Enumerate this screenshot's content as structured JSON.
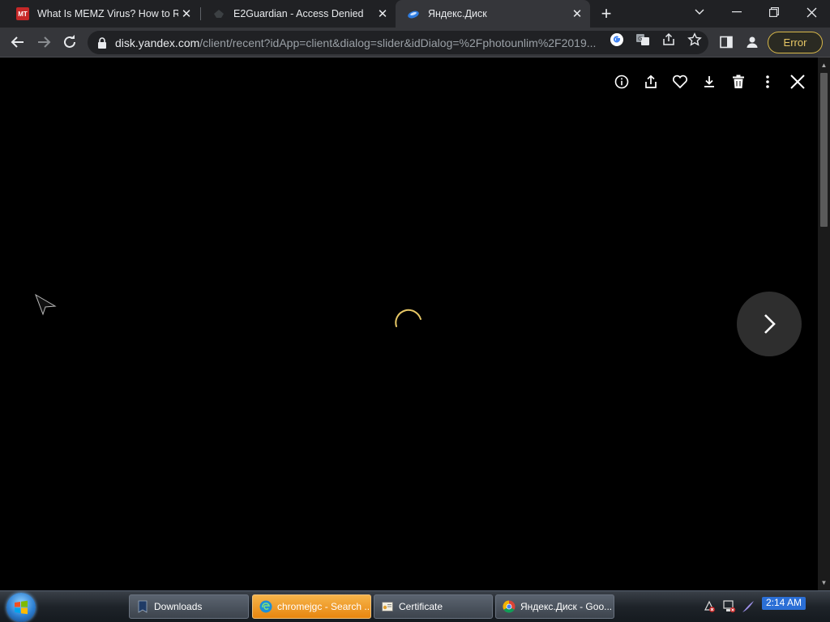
{
  "browser": {
    "tabs": [
      {
        "title": "What Is MEMZ Virus? How to Remove",
        "favicon": "minitool-favicon",
        "active": false
      },
      {
        "title": "E2Guardian - Access Denied",
        "favicon": "e2guardian-favicon",
        "active": false
      },
      {
        "title": "Яндекс.Диск",
        "favicon": "yandex-disk-favicon",
        "active": true
      }
    ],
    "favicon_text": {
      "minitool": "MT"
    },
    "url_host": "disk.yandex.com",
    "url_rest": "/client/recent?idApp=client&dialog=slider&idDialog=%2Fphotounlim%2F2019...",
    "profile_status": "Error"
  },
  "viewer": {
    "tools": [
      "info-icon",
      "share-icon",
      "favorite-icon",
      "download-icon",
      "delete-icon",
      "more-icon",
      "close-icon"
    ],
    "loading": true
  },
  "taskbar": {
    "items": [
      {
        "label": "Downloads",
        "icon": "downloads-folder-icon"
      },
      {
        "label": "chromejgc - Search ...",
        "icon": "edge-icon"
      },
      {
        "label": "Certificate",
        "icon": "certificate-icon"
      },
      {
        "label": "Яндекс.Диск - Goo...",
        "icon": "chrome-icon"
      }
    ],
    "clock": "2:14 AM"
  },
  "colors": {
    "tab_strip": "#202124",
    "toolbar": "#35363a",
    "viewer_bg": "#000000",
    "spinner": "#e8c866",
    "error_chip": "#d9b94a"
  }
}
